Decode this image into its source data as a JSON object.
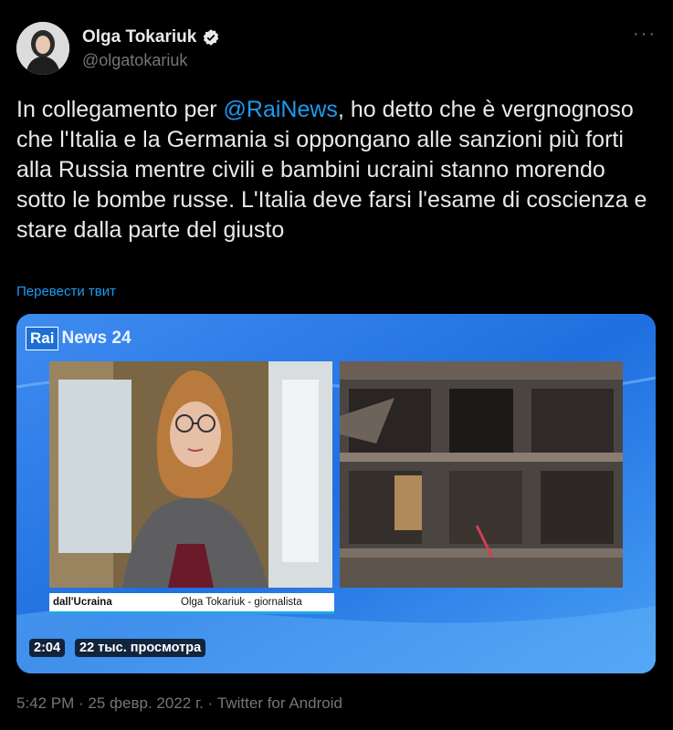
{
  "author": {
    "name": "Olga Tokariuk",
    "handle": "@olgatokariuk"
  },
  "more_icon": "more-horizontal-icon",
  "tweet": {
    "text_before": "In collegamento per ",
    "mention": "@RaiNews",
    "text_after": ", ho detto che è vergnognoso che l'Italia e la Germania si oppongano alle sanzioni più forti alla Russia mentre civili e bambini ucraini stanno morendo sotto le bombe russe. L'Italia deve farsi l'esame di coscienza e stare dalla parte del giusto"
  },
  "translate_label": "Перевести твит",
  "video": {
    "logo_box": "Rai",
    "logo_text": "News 24",
    "lower_third_place": "dall'Ucraina",
    "lower_third_name": "Olga Tokariuk - giornalista",
    "duration": "2:04",
    "views": "22 тыс. просмотра"
  },
  "footer": "5:42 PM · 25 февр. 2022 г. · Twitter for Android",
  "colors": {
    "background": "#000000",
    "text": "#e7e9ea",
    "muted": "#71767b",
    "link": "#1d9bf0"
  }
}
